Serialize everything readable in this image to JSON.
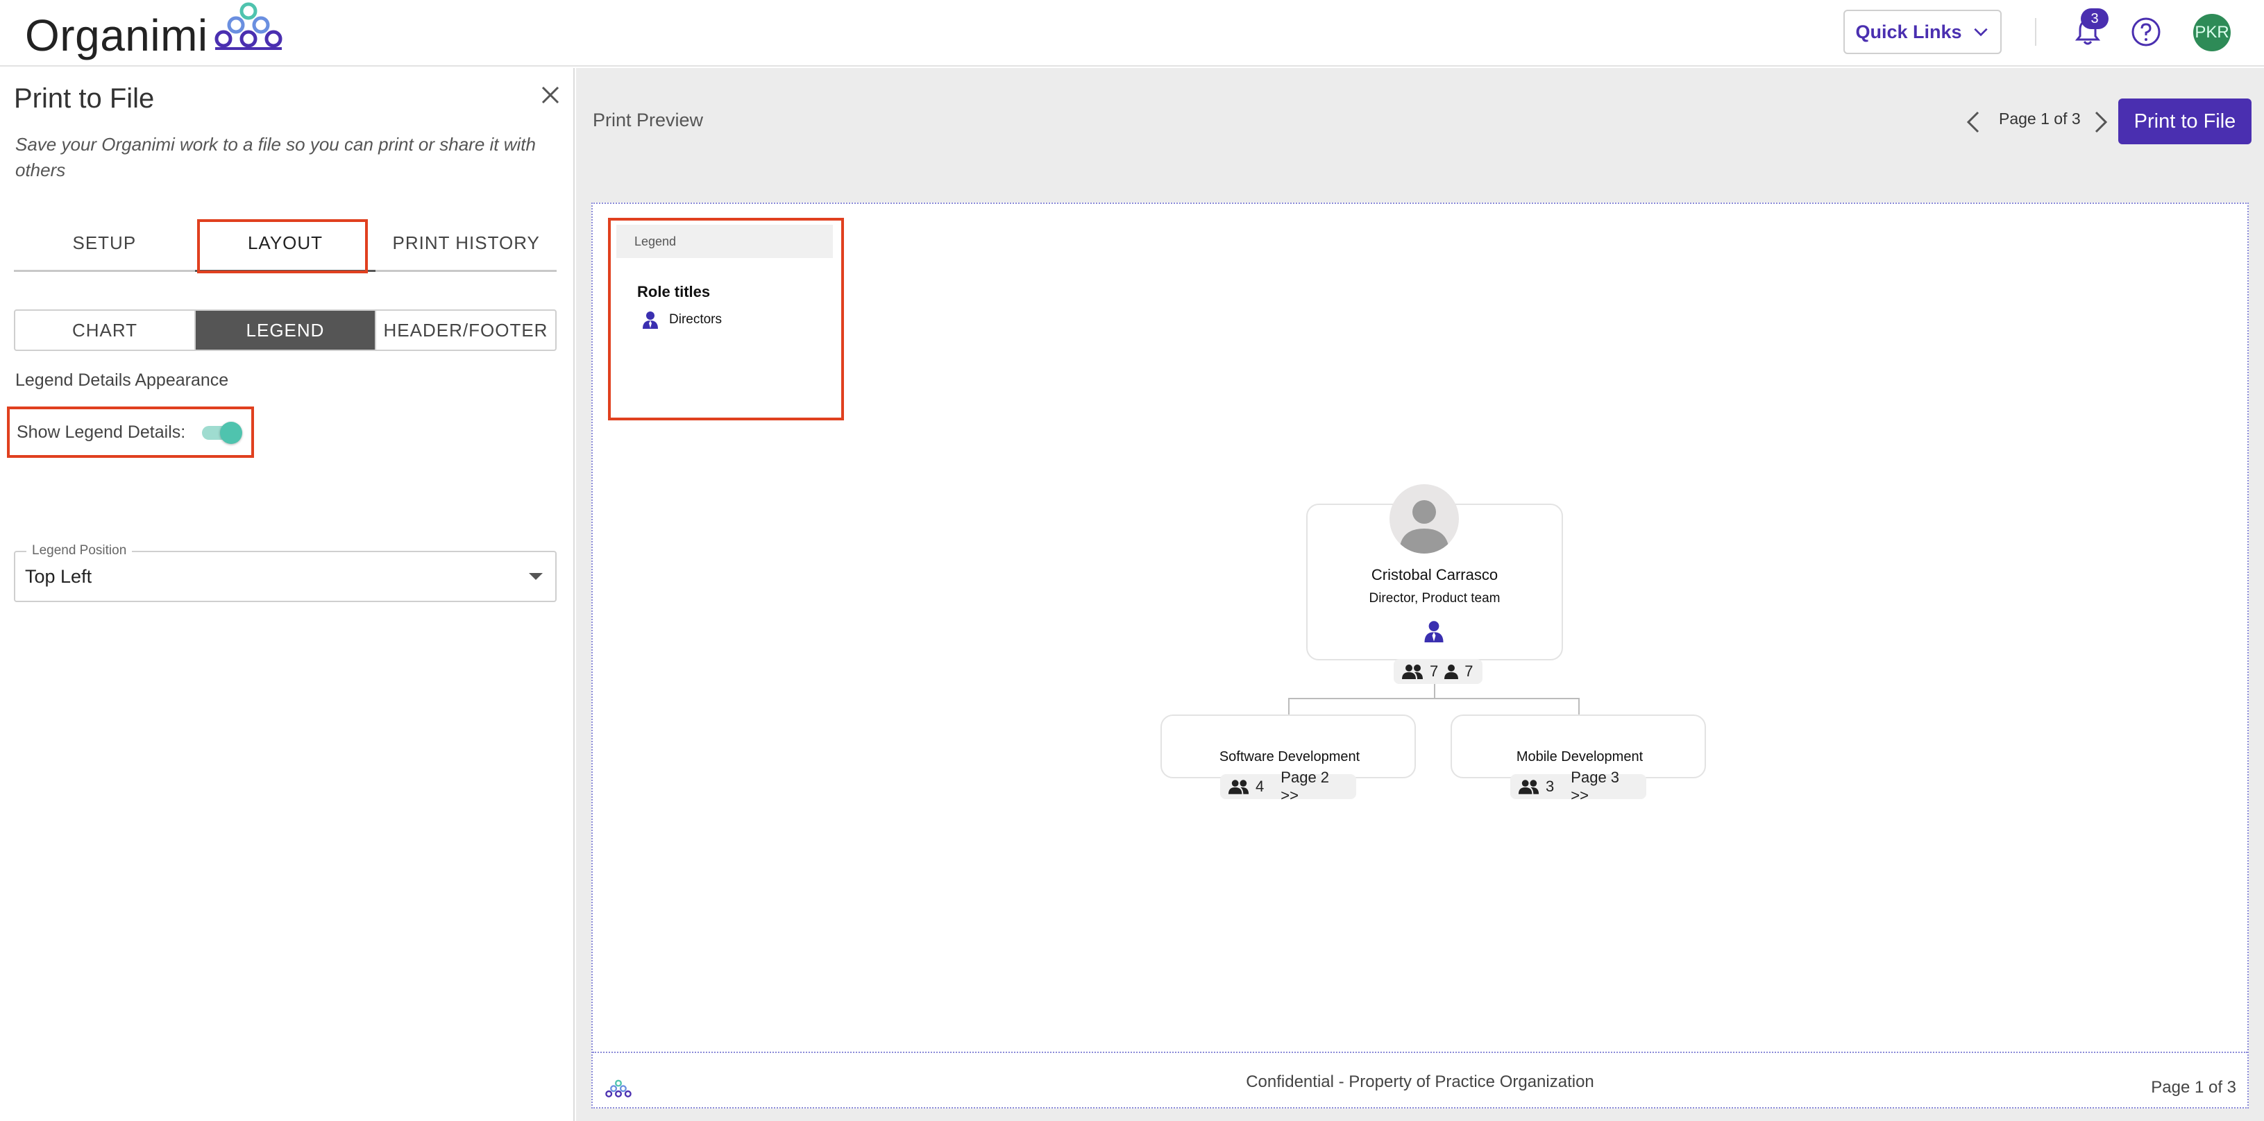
{
  "app": {
    "logo_text": "Organimi",
    "quick_links_label": "Quick Links",
    "notification_count": "3",
    "avatar_initials": "PKR"
  },
  "panel": {
    "title": "Print to File",
    "description": "Save your Organimi work to a file so you can print or share it with others",
    "tabs": [
      {
        "label": "SETUP"
      },
      {
        "label": "LAYOUT"
      },
      {
        "label": "PRINT HISTORY"
      }
    ],
    "active_tab": "LAYOUT",
    "segments": [
      {
        "label": "CHART"
      },
      {
        "label": "LEGEND"
      },
      {
        "label": "HEADER/FOOTER"
      }
    ],
    "active_segment": "LEGEND",
    "section_label": "Legend Details Appearance",
    "toggle_label": "Show Legend Details:",
    "toggle_on": true,
    "position_field_label": "Legend Position",
    "position_value": "Top Left"
  },
  "preview": {
    "title": "Print Preview",
    "pager_text": "Page 1 of 3",
    "print_button": "Print to File",
    "legend": {
      "header": "Legend",
      "group_title": "Role titles",
      "item_label": "Directors",
      "item_icon": "director-person-icon"
    },
    "main_card": {
      "name": "Cristobal Carrasco",
      "title": "Director, Product team",
      "team_count": "7",
      "direct_count": "7"
    },
    "sub_cards": [
      {
        "name": "Software Development",
        "count": "4",
        "page_link": "Page 2 >>"
      },
      {
        "name": "Mobile Development",
        "count": "3",
        "page_link": "Page 3 >>"
      }
    ],
    "footer_text": "Confidential - Property of Practice Organization",
    "footer_page": "Page 1 of 3"
  },
  "colors": {
    "accent": "#4a2fb0",
    "highlight": "#e0401f",
    "toggle": "#4fc3ae",
    "avatar_bg": "#2e8b57"
  }
}
